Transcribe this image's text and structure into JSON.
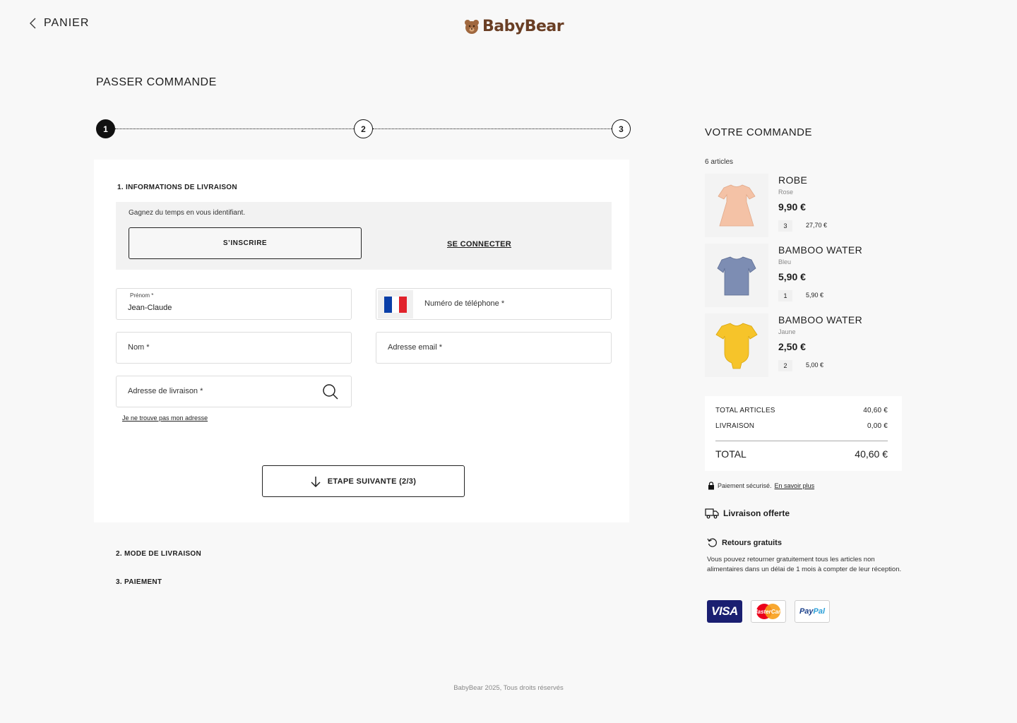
{
  "header": {
    "back_label": "PANIER",
    "logo_text": "BabyBear"
  },
  "page_title": "PASSER COMMANDE",
  "stepper": {
    "steps": [
      "1",
      "2",
      "3"
    ],
    "active": 1
  },
  "form": {
    "section1_title": "1. INFORMATIONS DE LIVRAISON",
    "login_hint": "Gagnez du temps en vous identifiant.",
    "register_label": "S’INSCRIRE",
    "login_label": "SE CONNECTER",
    "firstname_label": "Prénom *",
    "firstname_value": "Jean-Claude",
    "phone_placeholder": "Numéro de téléphone *",
    "lastname_placeholder": "Nom *",
    "email_placeholder": "Adresse email *",
    "address_placeholder": "Adresse de livraison *",
    "address_help": "Je ne trouve pas mon adresse",
    "next_label": "ETAPE SUIVANTE (2/3)",
    "flag_colors": [
      "#0a3fa8",
      "#ffffff",
      "#e1222b"
    ]
  },
  "sections": {
    "delivery_mode": "2. MODE DE LIVRAISON",
    "payment": "3. PAIEMENT"
  },
  "summary": {
    "title": "VOTRE COMMANDE",
    "count": "6 articles",
    "items": [
      {
        "name": "ROBE",
        "color": "Rose",
        "price": "9,90 €",
        "qty": "3",
        "total": "27,70 €",
        "swatch": "#f4c2a6"
      },
      {
        "name": "BAMBOO WATER",
        "color": "Bleu",
        "price": "5,90 €",
        "qty": "1",
        "total": "5,90 €",
        "swatch": "#7d8db3"
      },
      {
        "name": "BAMBOO WATER",
        "color": "Jaune",
        "price": "2,50 €",
        "qty": "2",
        "total": "5,00 €",
        "swatch": "#f6c42a"
      }
    ],
    "totals": {
      "articles_label": "TOTAL ARTICLES",
      "articles_value": "40,60 €",
      "shipping_label": "LIVRAISON",
      "shipping_value": "0,00 €",
      "total_label": "TOTAL",
      "total_value": "40,60 €"
    },
    "secure_text": "Paiement sécurisé.",
    "secure_link": "En savoir plus",
    "free_delivery": "Livraison offerte",
    "returns_title": "Retours gratuits",
    "returns_text": "Vous pouvez retourner gratuitement tous les articles non alimentaires dans un délai de 1 mois à compter de leur réception.",
    "payment_methods": {
      "visa": "VISA",
      "mastercard": "MasterCard",
      "paypal_a": "Pay",
      "paypal_b": "Pal"
    }
  },
  "footer": "BabyBear 2025, Tous droits réservés"
}
